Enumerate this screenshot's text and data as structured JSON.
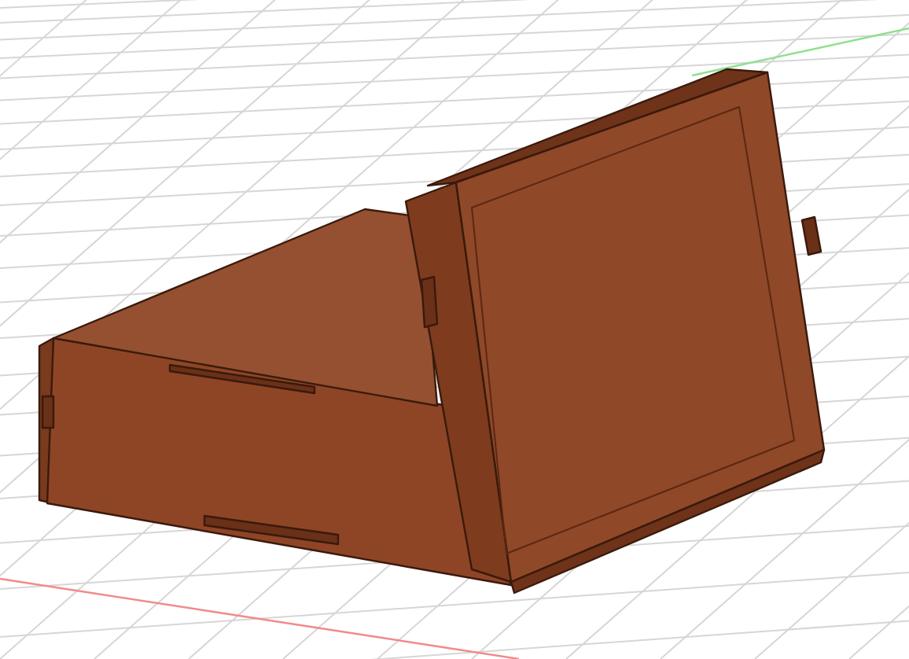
{
  "viewport": {
    "grid_visible": true,
    "axes_visible": true
  }
}
